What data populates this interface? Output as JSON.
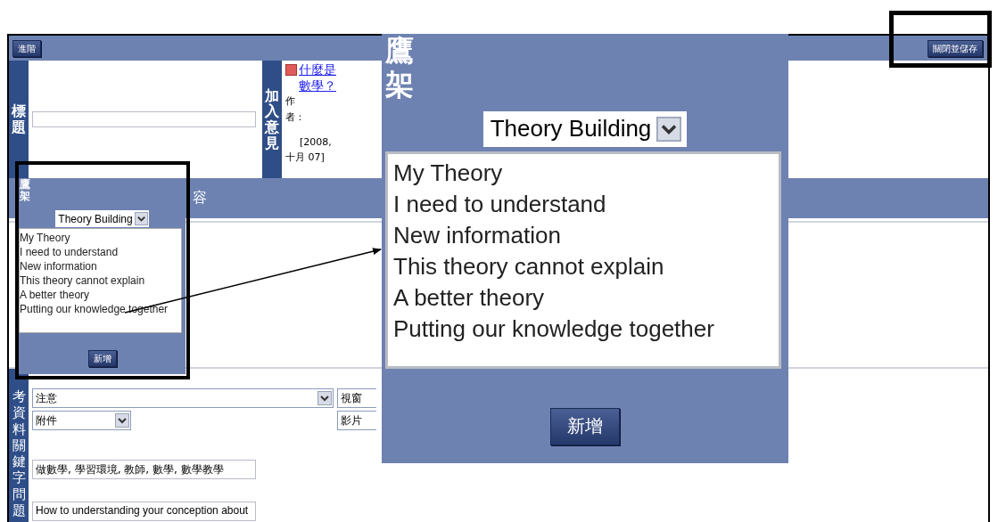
{
  "toolbar": {
    "buttons": [
      {
        "label": "進階"
      },
      {
        "label": "關閉並儲存",
        "highlighted": true
      }
    ]
  },
  "title_row": {
    "label": "標題",
    "comment_label": "加入意見",
    "comment": {
      "link": "什麼是數學？",
      "author_label": "作者：",
      "date": "[2008, 十月 07]"
    }
  },
  "content_header": "容",
  "reference": {
    "label": "考資料關鍵字問題",
    "rows": [
      {
        "select": "注意",
        "kind": "wide",
        "side": "視窗"
      },
      {
        "select": "附件",
        "kind": "narrow",
        "side": "影片"
      }
    ],
    "keywords": "做數學, 學習環境, 教師, 數學, 數學教學",
    "question": "How to understanding your conception about"
  },
  "scaffold_panel": {
    "label": "鷹架",
    "select": "Theory Building",
    "items": [
      "My Theory",
      "I need to understand",
      "New information",
      "This theory cannot explain",
      "A better theory",
      "Putting our knowledge together"
    ],
    "button": "新增"
  },
  "scaffold_zoom": {
    "label": "鷹架",
    "select": "Theory Building",
    "items": [
      "My Theory",
      "I need to understand",
      "New information",
      "This theory cannot explain",
      "A better theory",
      "Putting our knowledge together"
    ],
    "button": "新增"
  }
}
